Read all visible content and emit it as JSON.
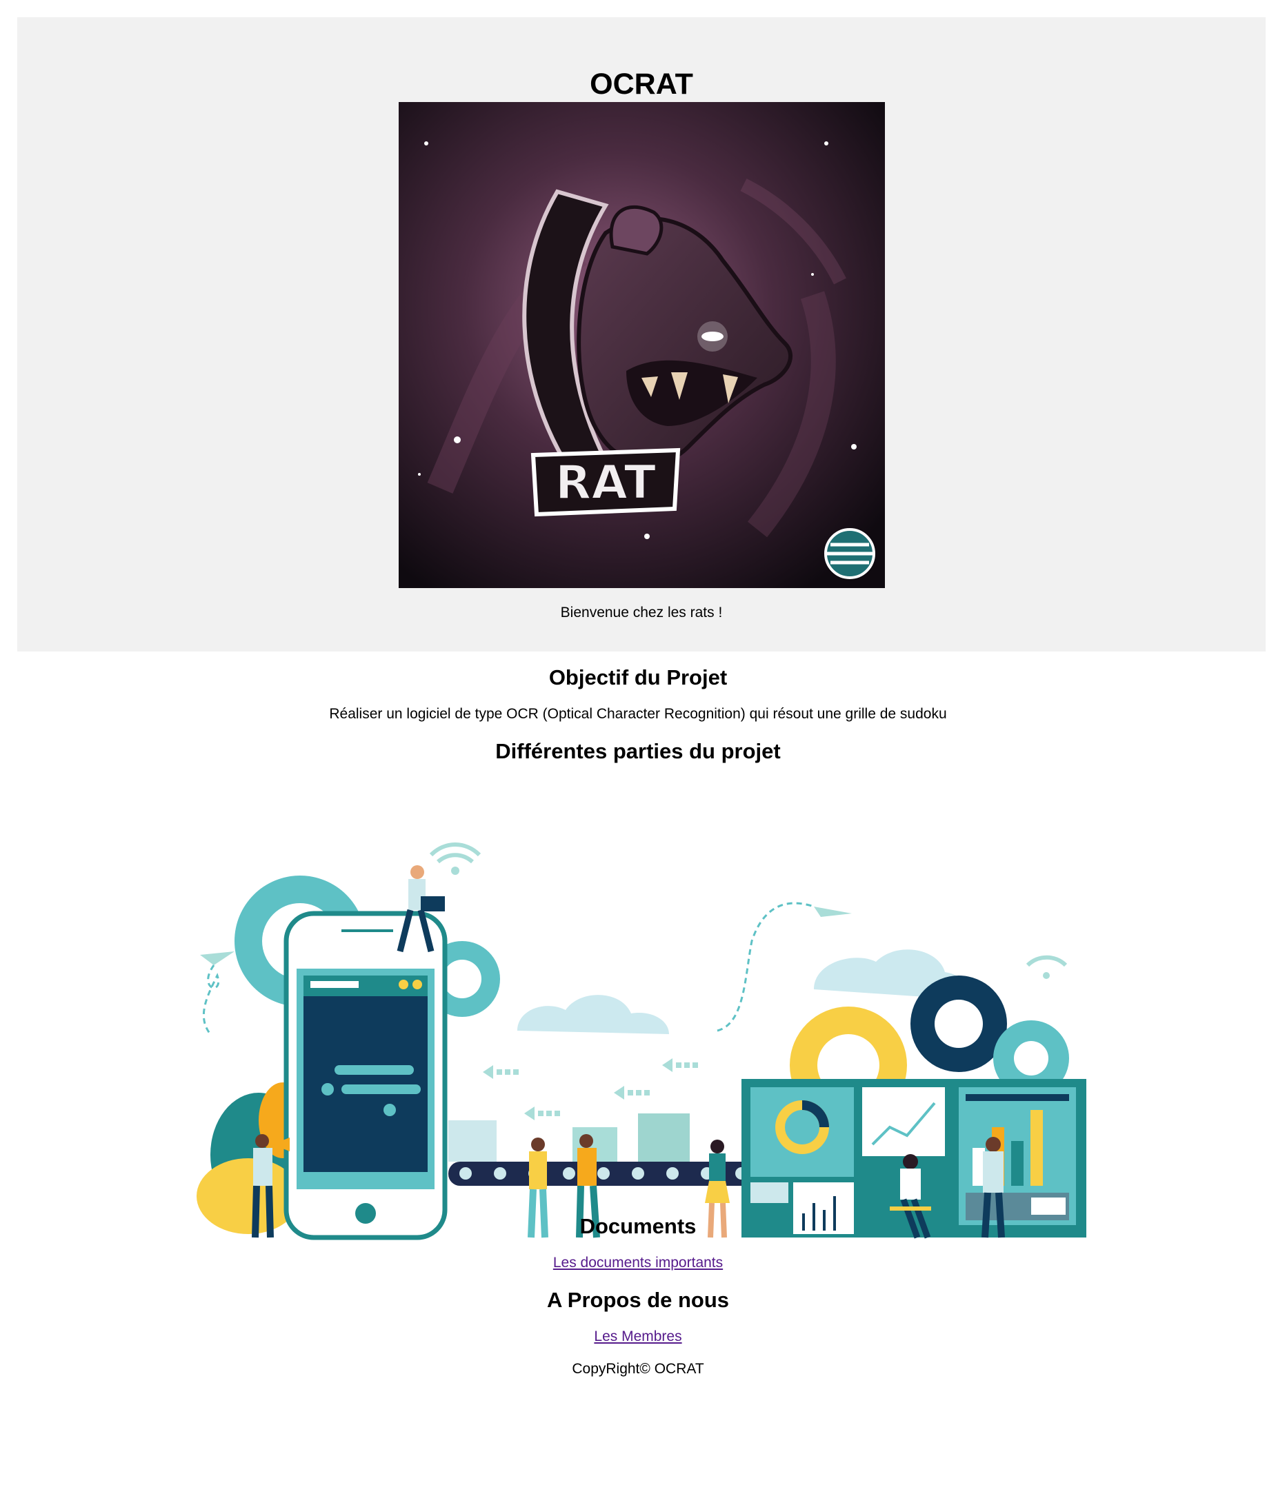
{
  "header": {
    "title": "OCRAT",
    "logo_text": "RAT",
    "welcome": "Bienvenue chez les rats !"
  },
  "objective": {
    "heading": "Objectif du Projet",
    "text": "Réaliser un logiciel de type OCR (Optical Character Recognition) qui résout une grille de sudoku"
  },
  "parts": {
    "heading": "Différentes parties du projet"
  },
  "documents": {
    "heading": "Documents",
    "link": "Les documents importants"
  },
  "about": {
    "heading": "A Propos de nous",
    "link": "Les Membres"
  },
  "footer": {
    "copyright": "CopyRight© OCRAT"
  },
  "colors": {
    "header_bg": "#f1f1f1",
    "visited_link": "#551a8b",
    "teal": "#1f8a8a",
    "navy": "#0e3b5c",
    "yellow": "#f8cf45"
  }
}
